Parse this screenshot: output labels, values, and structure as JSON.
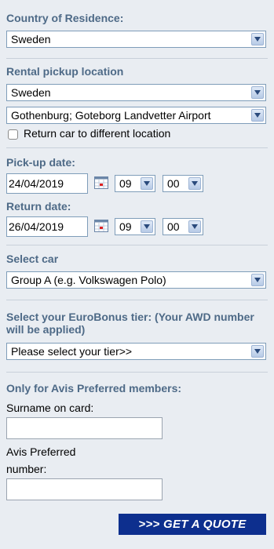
{
  "country": {
    "title": "Country of Residence:",
    "selected": "Sweden"
  },
  "pickup": {
    "title": "Rental pickup location",
    "country_selected": "Sweden",
    "location_selected": "Gothenburg; Goteborg Landvetter Airport",
    "return_different_label": "Return car to different location"
  },
  "pickup_date": {
    "title": "Pick-up date:",
    "date": "24/04/2019",
    "hour": "09",
    "minute": "00"
  },
  "return_date": {
    "title": "Return date:",
    "date": "26/04/2019",
    "hour": "09",
    "minute": "00"
  },
  "car": {
    "title": "Select car",
    "selected": "Group A (e.g. Volkswagen Polo)"
  },
  "eurobonus": {
    "title": "Select your EuroBonus tier: (Your AWD number will be applied)",
    "selected": "Please select your tier>>"
  },
  "avis": {
    "title": "Only for Avis Preferred members:",
    "surname_label": "Surname on card:",
    "surname_value": "",
    "number_label_line1": "Avis Preferred",
    "number_label_line2": "number:",
    "number_value": ""
  },
  "quote_button": ">>> GET A QUOTE",
  "colors": {
    "background": "#e9edf2",
    "section_title": "#4e6a87",
    "button_bg": "#0d2f8e",
    "button_text": "#ffffff"
  }
}
